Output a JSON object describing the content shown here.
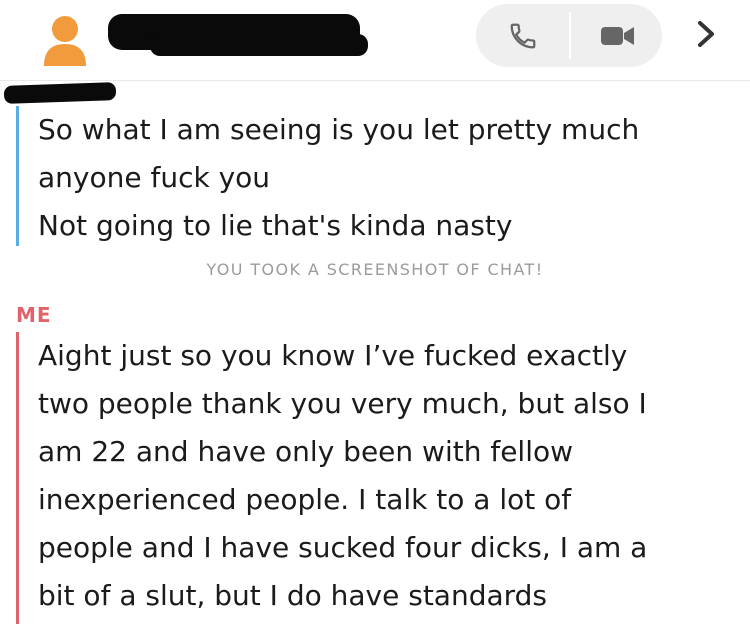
{
  "header": {
    "contact_name": "",
    "avatar_icon": "person-silhouette-icon",
    "call_icon": "phone-icon",
    "video_icon": "video-camera-icon",
    "more_icon": "chevron-right-icon",
    "colors": {
      "avatar": "#f29b3c",
      "pill_bg": "#efefef",
      "icon": "#666666"
    }
  },
  "messages": [
    {
      "sender": "",
      "bar_color": "#58aee3",
      "text": "So what I am seeing is you let pretty much\nanyone fuck you\nNot going to lie that's kinda nasty"
    },
    {
      "sender": "ME",
      "bar_color": "#e0626b",
      "text": "Aight just so you know I’ve fucked exactly\ntwo people thank you very much, but also I\nam 22 and have only been with fellow\ninexperienced people. I talk to a lot of\npeople and I have sucked four dicks, I am a\nbit of a slut, but I do have standards"
    }
  ],
  "notice": "YOU TOOK A SCREENSHOT OF CHAT!"
}
